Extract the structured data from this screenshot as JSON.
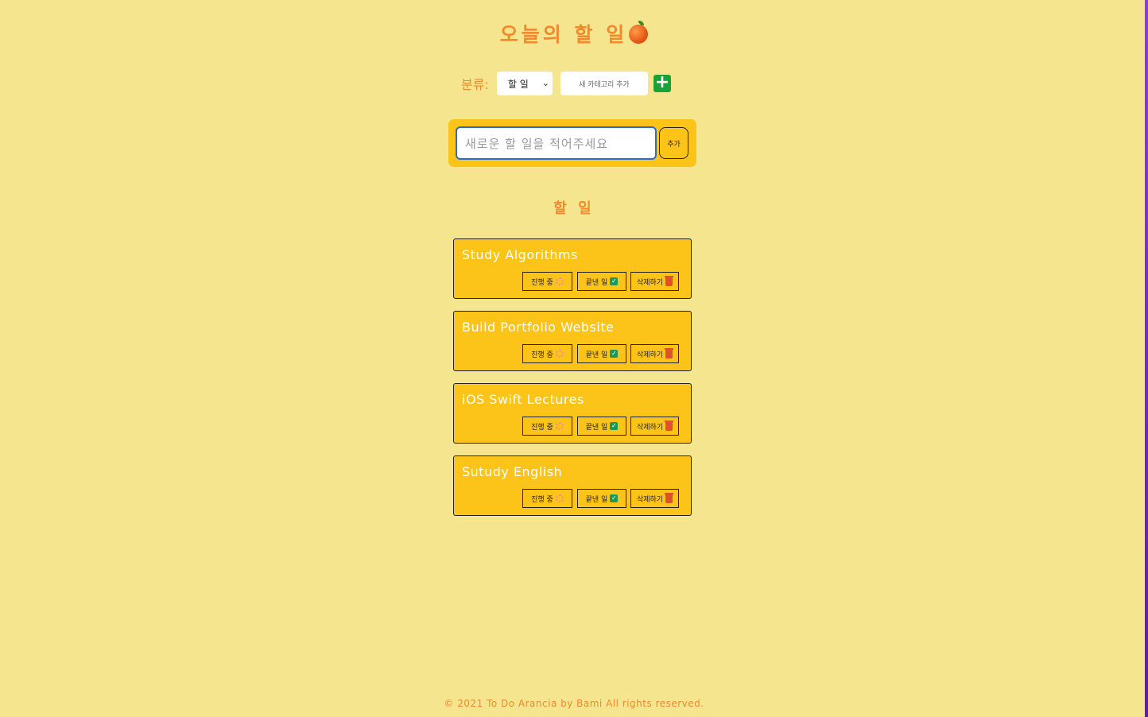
{
  "header": {
    "title": "오늘의 할 일"
  },
  "category": {
    "label": "분류:",
    "selected": "할 일",
    "new_placeholder": "새 카테고리 추가",
    "add_label": "+"
  },
  "todo_form": {
    "placeholder": "새로운 할 일을 적어주세요",
    "add_label": "추가"
  },
  "section_title": "할 일",
  "buttons": {
    "doing": "진행 중",
    "done": "끝낸 일",
    "delete": "삭제하기"
  },
  "todos": [
    {
      "title": "Study Algorithms"
    },
    {
      "title": "Build Portfolio Website"
    },
    {
      "title": "iOS Swift Lectures"
    },
    {
      "title": "Sutudy English"
    }
  ],
  "footer": "© 2021 To Do Arancia by Bami All rights reserved.",
  "colors": {
    "background": "#f4e58e",
    "accent": "#f08a2c",
    "card": "#fcc319",
    "add_green": "#1aa238"
  }
}
